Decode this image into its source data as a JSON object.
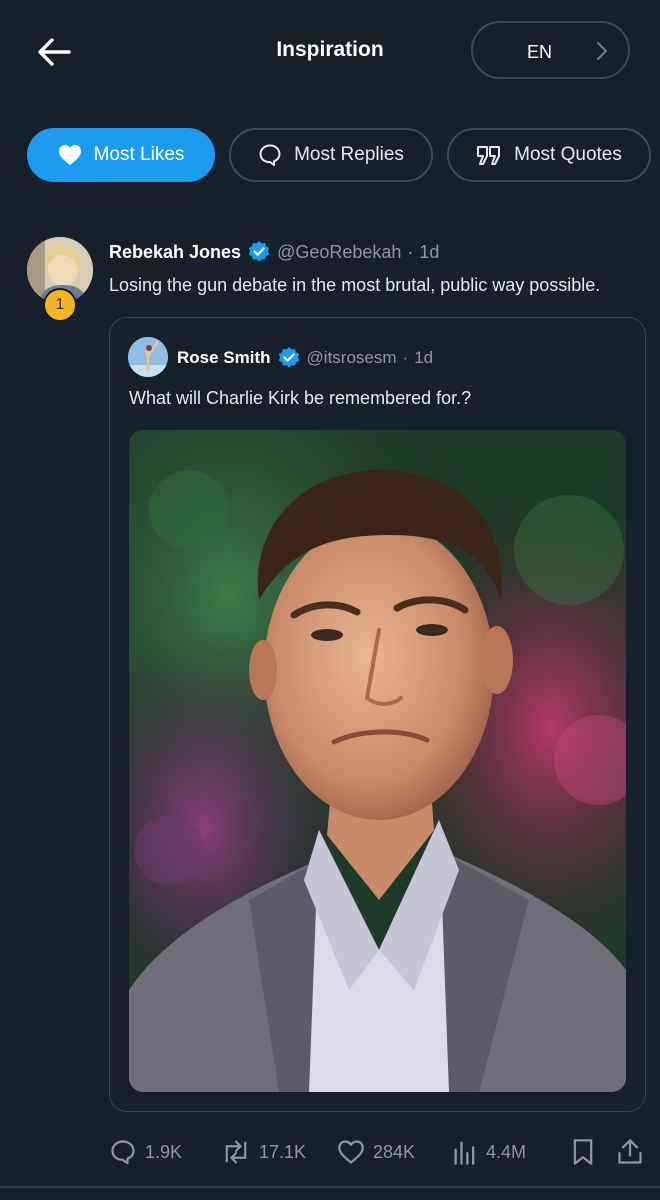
{
  "header": {
    "title": "Inspiration",
    "language": "EN"
  },
  "filters": [
    {
      "label": "Most Likes",
      "icon": "heart-icon",
      "active": true
    },
    {
      "label": "Most Replies",
      "icon": "reply-bubble-icon",
      "active": false
    },
    {
      "label": "Most Quotes",
      "icon": "quote-marks-icon",
      "active": false
    }
  ],
  "tweet": {
    "rank": "1",
    "author_name": "Rebekah Jones",
    "handle": "@GeoRebekah",
    "separator": "·",
    "time": "1d",
    "text": "Losing the gun debate in the most brutal, public way possible.",
    "quoted": {
      "author_name": "Rose Smith",
      "handle": "@itsrosesm",
      "separator": "·",
      "time": "1d",
      "text": "What will Charlie Kirk be remembered for.?"
    },
    "stats": {
      "replies": "1.9K",
      "retweets": "17.1K",
      "likes": "284K",
      "views": "4.4M"
    }
  },
  "colors": {
    "background": "#15202b",
    "accent": "#1d9bf0",
    "muted_text": "#8b98a5",
    "border": "#38444d",
    "rank_gold": "#f4b625"
  }
}
